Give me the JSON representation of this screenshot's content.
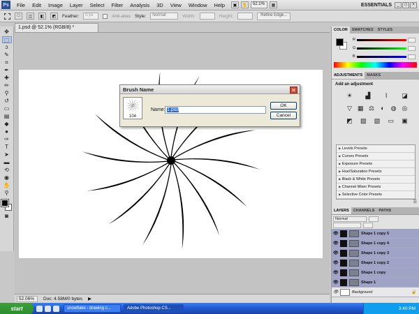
{
  "app": {
    "logo": "Ps"
  },
  "menu": [
    "File",
    "Edit",
    "Image",
    "Layer",
    "Select",
    "Filter",
    "Analysis",
    "3D",
    "View",
    "Window",
    "Help"
  ],
  "menubar_zoom": "52.1%",
  "workspace": "ESSENTIALS",
  "options_bar": {
    "feather_label": "Feather:",
    "feather_value": "0 px",
    "antialias_label": "Anti-alias",
    "style_label": "Style:",
    "style_value": "Normal",
    "width_label": "Width:",
    "height_label": "Height:",
    "refine_edge": "Refine Edge..."
  },
  "document": {
    "tab_title": "1.psd @ 52.1% (RGB/8) *",
    "status_zoom": "52.06%",
    "status_doc": "Doc: 4.58M/0 bytes"
  },
  "dialog": {
    "title": "Brush Name",
    "brush_size": "104",
    "name_label": "Name:",
    "name_value": "1.psd",
    "ok_label": "OK",
    "cancel_label": "Cancel"
  },
  "panels": {
    "color_tabs": [
      "COLOR",
      "SWATCHES",
      "STYLES"
    ],
    "rgb_labels": [
      "R",
      "G",
      "B"
    ],
    "adj_tabs": [
      "ADJUSTMENTS",
      "MASKS"
    ],
    "adj_title": "Add an adjustment",
    "presets": [
      "Levels Presets",
      "Curves Presets",
      "Exposure Presets",
      "Hue/Saturation Presets",
      "Black & White Presets",
      "Channel Mixer Presets",
      "Selective Color Presets"
    ],
    "layer_tabs": [
      "LAYERS",
      "CHANNELS",
      "PATHS"
    ],
    "blend_mode": "Normal",
    "layers": [
      "Shape 1 copy 5",
      "Shape 1 copy 4",
      "Shape 1 copy 3",
      "Shape 1 copy 2",
      "Shape 1 copy",
      "Shape 1",
      "Background"
    ]
  },
  "taskbar": {
    "start": "start",
    "tasks": [
      "snowflake - drawing c...",
      "Adobe Photoshop CS..."
    ],
    "time": "3:40 PM"
  },
  "colors": {
    "layer_selected": "#9fa3c6",
    "taskbar": "#245edb",
    "dialog_bg": "#ece9d8"
  }
}
